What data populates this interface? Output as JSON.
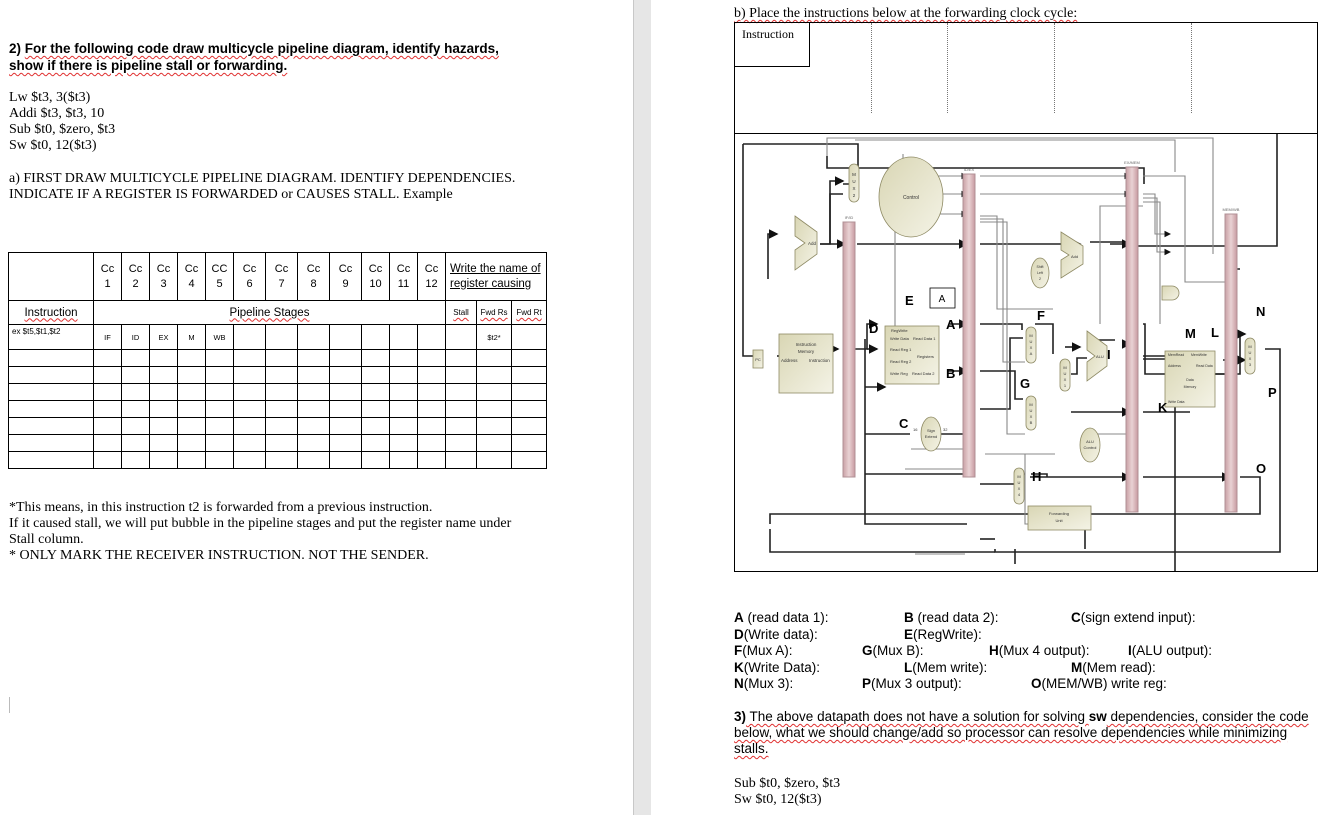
{
  "question2": {
    "number": "2)",
    "title_line1": "For the following code draw multicycle pipeline diagram, identify hazards,",
    "title_line2": "show if there is pipeline stall or forwarding."
  },
  "code": [
    "Lw $t3, 3($t3)",
    "Addi $t3, $t3, 10",
    "Sub $t0, $zero, $t3",
    "Sw $t0, 12($t3)"
  ],
  "part_a": {
    "line1": "a) FIRST DRAW MULTICYCLE PIPELINE DIAGRAM. IDENTIFY DEPENDENCIES.",
    "line2": "INDICATE IF A REGISTER IS FORWARDED or CAUSES STALL. Example"
  },
  "pipeline_table": {
    "clock_cycles": [
      {
        "top": "Cc",
        "num": "1"
      },
      {
        "top": "Cc",
        "num": "2"
      },
      {
        "top": "Cc",
        "num": "3"
      },
      {
        "top": "Cc",
        "num": "4"
      },
      {
        "top": "CC",
        "num": "5"
      },
      {
        "top": "Cc",
        "num": "6"
      },
      {
        "top": "Cc",
        "num": "7"
      },
      {
        "top": "Cc",
        "num": "8"
      },
      {
        "top": "Cc",
        "num": "9"
      },
      {
        "top": "Cc",
        "num": "10"
      },
      {
        "top": "Cc",
        "num": "11"
      },
      {
        "top": "Cc",
        "num": "12"
      }
    ],
    "register_header": "Write the name of register causing",
    "instruction_header": "Instruction",
    "stages_header": "Pipeline Stages",
    "stall_header": "Stall",
    "fwd_rs_header": "Fwd Rs",
    "fwd_rt_header": "Fwd Rt",
    "example_row": {
      "instruction": "ex $t5,$t1,$t2",
      "stages": [
        "IF",
        "ID",
        "EX",
        "M",
        "WB",
        "",
        "",
        "",
        "",
        "",
        "",
        ""
      ],
      "stall": "",
      "fwd_rs": "$t2*",
      "fwd_rt": ""
    },
    "empty_rows": 7
  },
  "notes": {
    "line1": "*This means, in this instruction t2 is forwarded from a previous instruction.",
    "line2": "If it caused stall, we will put bubble in the pipeline stages and put the register name under",
    "line3": "Stall column.",
    "line4": "* ONLY MARK THE RECEIVER INSTRUCTION. NOT THE SENDER."
  },
  "part_b": {
    "title": "b) Place the instructions below at the forwarding clock cycle:",
    "instruction_cell": "Instruction"
  },
  "datapath": {
    "pipeline_registers": [
      "IF/ID",
      "ID/EX",
      "EX/MEM",
      "MEM/WB"
    ],
    "components": {
      "control": "Control",
      "add": "Add",
      "pc": "PC",
      "instruction_memory": [
        "Instruction",
        "Memory"
      ],
      "im_address": "Address",
      "im_instruction": "Instruction",
      "registers": "Registers",
      "reg_write": "RegWrite",
      "write_data": "Write Data",
      "read_reg1": "Read Reg 1",
      "read_reg2": "Read Reg 2",
      "write_reg": "Write Reg",
      "read_data1": "Read Data 1",
      "read_data2": "Read Data 2",
      "sign_extend": [
        "Sign",
        "Extend"
      ],
      "bits_in": "16",
      "bits_out": "32",
      "shift_left": [
        "Shift",
        "Left",
        "2"
      ],
      "alu": "ALU",
      "alu_control": [
        "ALU",
        "Control"
      ],
      "forwarding_unit": [
        "Forwarding",
        "Unit"
      ],
      "data_memory": [
        "Data",
        "Memory"
      ],
      "mem_read": "MemRead",
      "mem_write": "MemWrite",
      "dm_address": "Address",
      "dm_read_data": "Read Data",
      "dm_write_data": "Write Data",
      "mux2": "MUX 2",
      "muxA": "MUX A",
      "muxB": "MUX B",
      "mux1": "MUX 1",
      "mux3": "MUX 3",
      "mux4": "MUX 4"
    },
    "point_labels": [
      "A",
      "B",
      "C",
      "D",
      "E",
      "F",
      "G",
      "H",
      "I",
      "K",
      "L",
      "M",
      "N",
      "O",
      "P"
    ],
    "boxed_label": "A"
  },
  "legend": [
    {
      "key": "A",
      "text": " (read data 1):"
    },
    {
      "key": "B",
      "text": " (read data 2):"
    },
    {
      "key": "C",
      "text": "(sign extend input):"
    },
    {
      "key": "D",
      "text": "(Write data):"
    },
    {
      "key": "E",
      "text": "(RegWrite):"
    },
    {
      "key": "F",
      "text": "(Mux A):"
    },
    {
      "key": "G",
      "text": "(Mux B):"
    },
    {
      "key": "H",
      "text": "(Mux 4 output):"
    },
    {
      "key": "I",
      "text": "(ALU output):"
    },
    {
      "key": "K",
      "text": "(Write Data):"
    },
    {
      "key": "L",
      "text": "(Mem write):"
    },
    {
      "key": "M",
      "text": "(Mem read):"
    },
    {
      "key": "N",
      "text": "(Mux 3):"
    },
    {
      "key": "P",
      "text": "(Mux 3 output):"
    },
    {
      "key": "O",
      "text": "(MEM/WB) write reg:"
    }
  ],
  "question3": {
    "number": "3)",
    "text_pre": " The above datapath does not have a solution for solving ",
    "bold_word": "sw",
    "text_post": " dependencies, consider the code below, what we should change/add so processor can resolve dependencies while minimizing stalls.",
    "code": [
      "Sub $t0, $zero, $t3",
      "Sw $t0, 12($t3)"
    ]
  }
}
